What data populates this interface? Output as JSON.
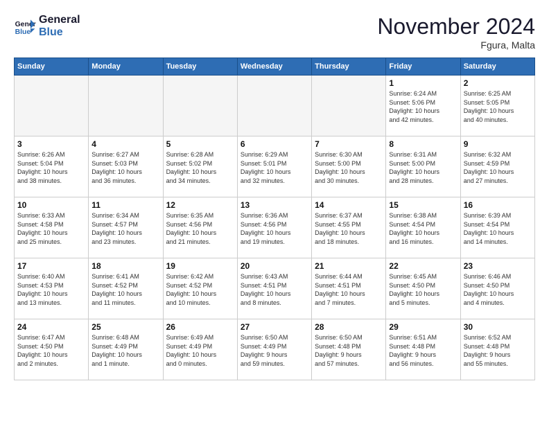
{
  "logo": {
    "line1": "General",
    "line2": "Blue"
  },
  "title": "November 2024",
  "location": "Fgura, Malta",
  "weekdays": [
    "Sunday",
    "Monday",
    "Tuesday",
    "Wednesday",
    "Thursday",
    "Friday",
    "Saturday"
  ],
  "weeks": [
    [
      {
        "day": "",
        "content": ""
      },
      {
        "day": "",
        "content": ""
      },
      {
        "day": "",
        "content": ""
      },
      {
        "day": "",
        "content": ""
      },
      {
        "day": "",
        "content": ""
      },
      {
        "day": "1",
        "content": "Sunrise: 6:24 AM\nSunset: 5:06 PM\nDaylight: 10 hours\nand 42 minutes."
      },
      {
        "day": "2",
        "content": "Sunrise: 6:25 AM\nSunset: 5:05 PM\nDaylight: 10 hours\nand 40 minutes."
      }
    ],
    [
      {
        "day": "3",
        "content": "Sunrise: 6:26 AM\nSunset: 5:04 PM\nDaylight: 10 hours\nand 38 minutes."
      },
      {
        "day": "4",
        "content": "Sunrise: 6:27 AM\nSunset: 5:03 PM\nDaylight: 10 hours\nand 36 minutes."
      },
      {
        "day": "5",
        "content": "Sunrise: 6:28 AM\nSunset: 5:02 PM\nDaylight: 10 hours\nand 34 minutes."
      },
      {
        "day": "6",
        "content": "Sunrise: 6:29 AM\nSunset: 5:01 PM\nDaylight: 10 hours\nand 32 minutes."
      },
      {
        "day": "7",
        "content": "Sunrise: 6:30 AM\nSunset: 5:00 PM\nDaylight: 10 hours\nand 30 minutes."
      },
      {
        "day": "8",
        "content": "Sunrise: 6:31 AM\nSunset: 5:00 PM\nDaylight: 10 hours\nand 28 minutes."
      },
      {
        "day": "9",
        "content": "Sunrise: 6:32 AM\nSunset: 4:59 PM\nDaylight: 10 hours\nand 27 minutes."
      }
    ],
    [
      {
        "day": "10",
        "content": "Sunrise: 6:33 AM\nSunset: 4:58 PM\nDaylight: 10 hours\nand 25 minutes."
      },
      {
        "day": "11",
        "content": "Sunrise: 6:34 AM\nSunset: 4:57 PM\nDaylight: 10 hours\nand 23 minutes."
      },
      {
        "day": "12",
        "content": "Sunrise: 6:35 AM\nSunset: 4:56 PM\nDaylight: 10 hours\nand 21 minutes."
      },
      {
        "day": "13",
        "content": "Sunrise: 6:36 AM\nSunset: 4:56 PM\nDaylight: 10 hours\nand 19 minutes."
      },
      {
        "day": "14",
        "content": "Sunrise: 6:37 AM\nSunset: 4:55 PM\nDaylight: 10 hours\nand 18 minutes."
      },
      {
        "day": "15",
        "content": "Sunrise: 6:38 AM\nSunset: 4:54 PM\nDaylight: 10 hours\nand 16 minutes."
      },
      {
        "day": "16",
        "content": "Sunrise: 6:39 AM\nSunset: 4:54 PM\nDaylight: 10 hours\nand 14 minutes."
      }
    ],
    [
      {
        "day": "17",
        "content": "Sunrise: 6:40 AM\nSunset: 4:53 PM\nDaylight: 10 hours\nand 13 minutes."
      },
      {
        "day": "18",
        "content": "Sunrise: 6:41 AM\nSunset: 4:52 PM\nDaylight: 10 hours\nand 11 minutes."
      },
      {
        "day": "19",
        "content": "Sunrise: 6:42 AM\nSunset: 4:52 PM\nDaylight: 10 hours\nand 10 minutes."
      },
      {
        "day": "20",
        "content": "Sunrise: 6:43 AM\nSunset: 4:51 PM\nDaylight: 10 hours\nand 8 minutes."
      },
      {
        "day": "21",
        "content": "Sunrise: 6:44 AM\nSunset: 4:51 PM\nDaylight: 10 hours\nand 7 minutes."
      },
      {
        "day": "22",
        "content": "Sunrise: 6:45 AM\nSunset: 4:50 PM\nDaylight: 10 hours\nand 5 minutes."
      },
      {
        "day": "23",
        "content": "Sunrise: 6:46 AM\nSunset: 4:50 PM\nDaylight: 10 hours\nand 4 minutes."
      }
    ],
    [
      {
        "day": "24",
        "content": "Sunrise: 6:47 AM\nSunset: 4:50 PM\nDaylight: 10 hours\nand 2 minutes."
      },
      {
        "day": "25",
        "content": "Sunrise: 6:48 AM\nSunset: 4:49 PM\nDaylight: 10 hours\nand 1 minute."
      },
      {
        "day": "26",
        "content": "Sunrise: 6:49 AM\nSunset: 4:49 PM\nDaylight: 10 hours\nand 0 minutes."
      },
      {
        "day": "27",
        "content": "Sunrise: 6:50 AM\nSunset: 4:49 PM\nDaylight: 9 hours\nand 59 minutes."
      },
      {
        "day": "28",
        "content": "Sunrise: 6:50 AM\nSunset: 4:48 PM\nDaylight: 9 hours\nand 57 minutes."
      },
      {
        "day": "29",
        "content": "Sunrise: 6:51 AM\nSunset: 4:48 PM\nDaylight: 9 hours\nand 56 minutes."
      },
      {
        "day": "30",
        "content": "Sunrise: 6:52 AM\nSunset: 4:48 PM\nDaylight: 9 hours\nand 55 minutes."
      }
    ]
  ]
}
